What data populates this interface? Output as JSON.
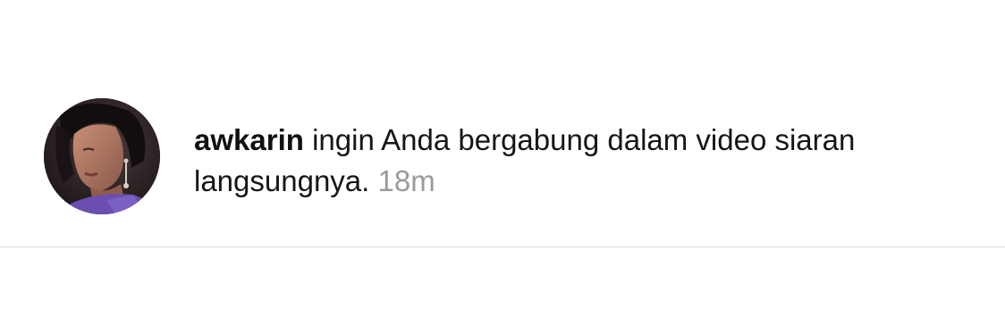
{
  "notification": {
    "username": "awkarin",
    "message": "ingin Anda bergabung dalam video siaran langsungnya.",
    "timestamp": "18m"
  },
  "colors": {
    "text": "#161616",
    "timestamp": "#9a9a9a",
    "divider": "#dcdcdc",
    "background": "#ffffff"
  }
}
